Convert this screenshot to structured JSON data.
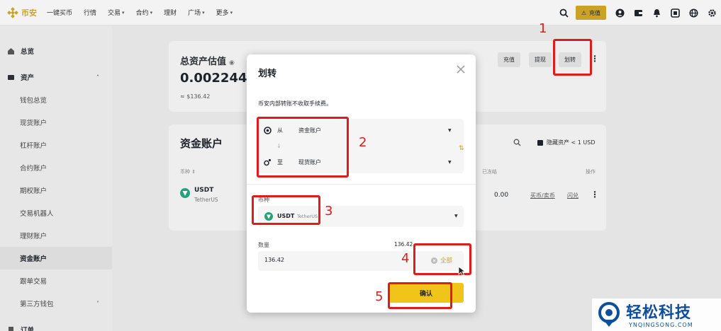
{
  "brand": {
    "name": "币安",
    "color": "#c9a227"
  },
  "nav": {
    "items": [
      {
        "label": "一键买币",
        "has_caret": false
      },
      {
        "label": "行情",
        "has_caret": false
      },
      {
        "label": "交易",
        "has_caret": true
      },
      {
        "label": "合约",
        "has_caret": true
      },
      {
        "label": "理财",
        "has_caret": false
      },
      {
        "label": "广场",
        "has_caret": true
      },
      {
        "label": "更多",
        "has_caret": true
      }
    ],
    "deposit_label": "充值",
    "icons": [
      "search-icon",
      "user-icon",
      "wallet-icon",
      "bell-icon",
      "download-icon",
      "globe-icon",
      "settings-icon"
    ]
  },
  "sidebar": {
    "items": [
      {
        "label": "总览",
        "icon": "home-icon",
        "type": "top"
      },
      {
        "label": "资产",
        "icon": "wallet-icon",
        "type": "top",
        "chevron": "˄"
      },
      {
        "label": "钱包总览",
        "type": "sub"
      },
      {
        "label": "现货账户",
        "type": "sub"
      },
      {
        "label": "杠杆账户",
        "type": "sub"
      },
      {
        "label": "合约账户",
        "type": "sub"
      },
      {
        "label": "期权账户",
        "type": "sub"
      },
      {
        "label": "交易机器人",
        "type": "sub"
      },
      {
        "label": "理财账户",
        "type": "sub"
      },
      {
        "label": "资金账户",
        "type": "sub",
        "active": true
      },
      {
        "label": "跟单交易",
        "type": "sub"
      },
      {
        "label": "第三方钱包",
        "type": "sub",
        "chevron": "˅"
      },
      {
        "label": "订单",
        "icon": "order-icon",
        "type": "top"
      }
    ]
  },
  "main": {
    "assets_title": "总资产估值",
    "big_amount": "0.0022443",
    "approx": "≈ $136.42",
    "actions": [
      "充值",
      "提现",
      "划转"
    ],
    "funding_title": "资金账户",
    "hide_small": "隐藏资产 < 1 USD",
    "table_headers": {
      "coin": "币种 ⇕",
      "frozen": "已冻结",
      "action": "操作"
    },
    "row": {
      "symbol": "USDT",
      "name": "TetherUS",
      "value": "0.00",
      "link1": "买币/卖币",
      "link2": "闪兑"
    }
  },
  "modal": {
    "title": "划转",
    "note": "币安内部转账不收取手续费。",
    "from_label": "从",
    "from_account": "资金账户",
    "to_label": "至",
    "to_account": "现货账户",
    "coin_label": "币种",
    "coin_symbol": "USDT",
    "coin_name": "TetherUS",
    "qty_label": "数量",
    "available": "136.42",
    "qty_value": "136.42",
    "max_label": "全部",
    "confirm_label": "确认"
  },
  "annotations": [
    "1",
    "2",
    "3",
    "4",
    "5"
  ],
  "watermark": {
    "text": "轻松科技",
    "url": "YNQINGSONG.COM"
  },
  "colors": {
    "accent": "#f0c419",
    "annotation": "#e01b1b",
    "watermark": "#0d4f9c"
  }
}
